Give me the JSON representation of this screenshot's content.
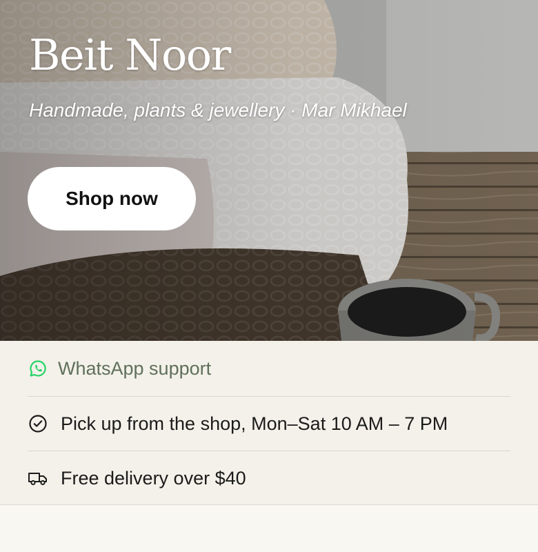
{
  "hero": {
    "brand": "Beit Noor",
    "tagline": "Handmade, plants & jewellery · Mar Mikhael",
    "cta_label": "Shop now"
  },
  "features": {
    "items": [
      {
        "icon": "whatsapp-icon",
        "label": "WhatsApp support",
        "color": "#5f705b",
        "icon_color": "#25d366"
      },
      {
        "icon": "check-circle-icon",
        "label": "Pick up from the shop, Mon–Sat 10 AM – 7 PM"
      },
      {
        "icon": "truck-icon",
        "label": "Free delivery over $40"
      }
    ]
  }
}
